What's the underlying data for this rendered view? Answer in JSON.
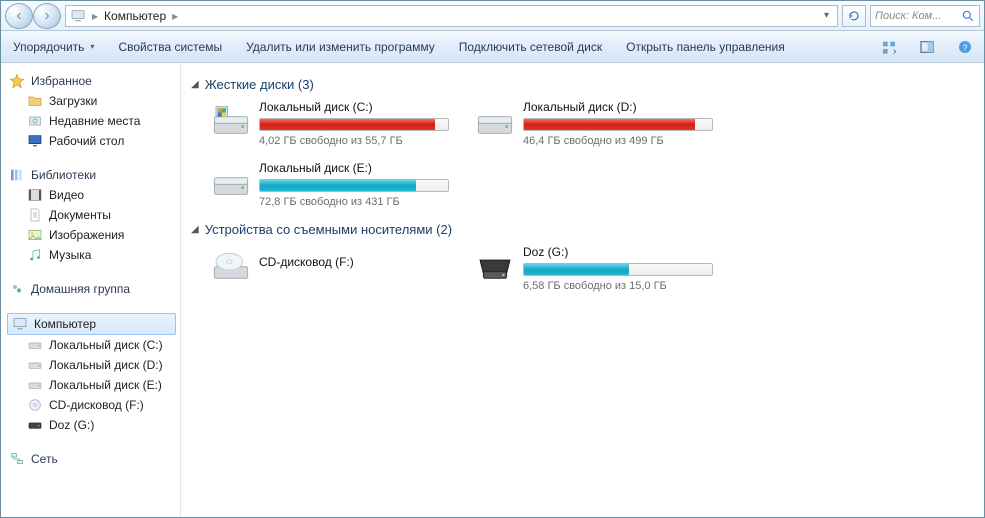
{
  "breadcrumb": {
    "root": "Компьютер",
    "sep": "▸"
  },
  "search": {
    "placeholder": "Поиск: Ком..."
  },
  "toolbar": {
    "organize": "Упорядочить",
    "properties": "Свойства системы",
    "uninstall": "Удалить или изменить программу",
    "map_drive": "Подключить сетевой диск",
    "control_panel": "Открыть панель управления"
  },
  "sidebar": {
    "favorites": {
      "title": "Избранное",
      "items": [
        "Загрузки",
        "Недавние места",
        "Рабочий стол"
      ]
    },
    "libraries": {
      "title": "Библиотеки",
      "items": [
        "Видео",
        "Документы",
        "Изображения",
        "Музыка"
      ]
    },
    "homegroup": {
      "title": "Домашняя группа"
    },
    "computer": {
      "title": "Компьютер",
      "items": [
        "Локальный диск (C:)",
        "Локальный диск (D:)",
        "Локальный диск (E:)",
        "CD-дисковод (F:)",
        "Doz (G:)"
      ]
    },
    "network": {
      "title": "Сеть"
    }
  },
  "groups": {
    "hdd": {
      "title": "Жесткие диски (3)"
    },
    "removable": {
      "title": "Устройства со съемными носителями (2)"
    }
  },
  "drives": {
    "c": {
      "name": "Локальный диск (C:)",
      "sub": "4,02 ГБ свободно из 55,7 ГБ",
      "fill_pct": 93,
      "color": "red"
    },
    "d": {
      "name": "Локальный диск (D:)",
      "sub": "46,4 ГБ свободно из 499 ГБ",
      "fill_pct": 91,
      "color": "red"
    },
    "e": {
      "name": "Локальный диск (E:)",
      "sub": "72,8 ГБ свободно из 431 ГБ",
      "fill_pct": 83,
      "color": "cyan"
    },
    "f": {
      "name": "CD-дисковод (F:)",
      "sub": "",
      "fill_pct": 0,
      "color": "none"
    },
    "g": {
      "name": "Doz (G:)",
      "sub": "6,58 ГБ свободно из 15,0 ГБ",
      "fill_pct": 56,
      "color": "cyan"
    }
  }
}
